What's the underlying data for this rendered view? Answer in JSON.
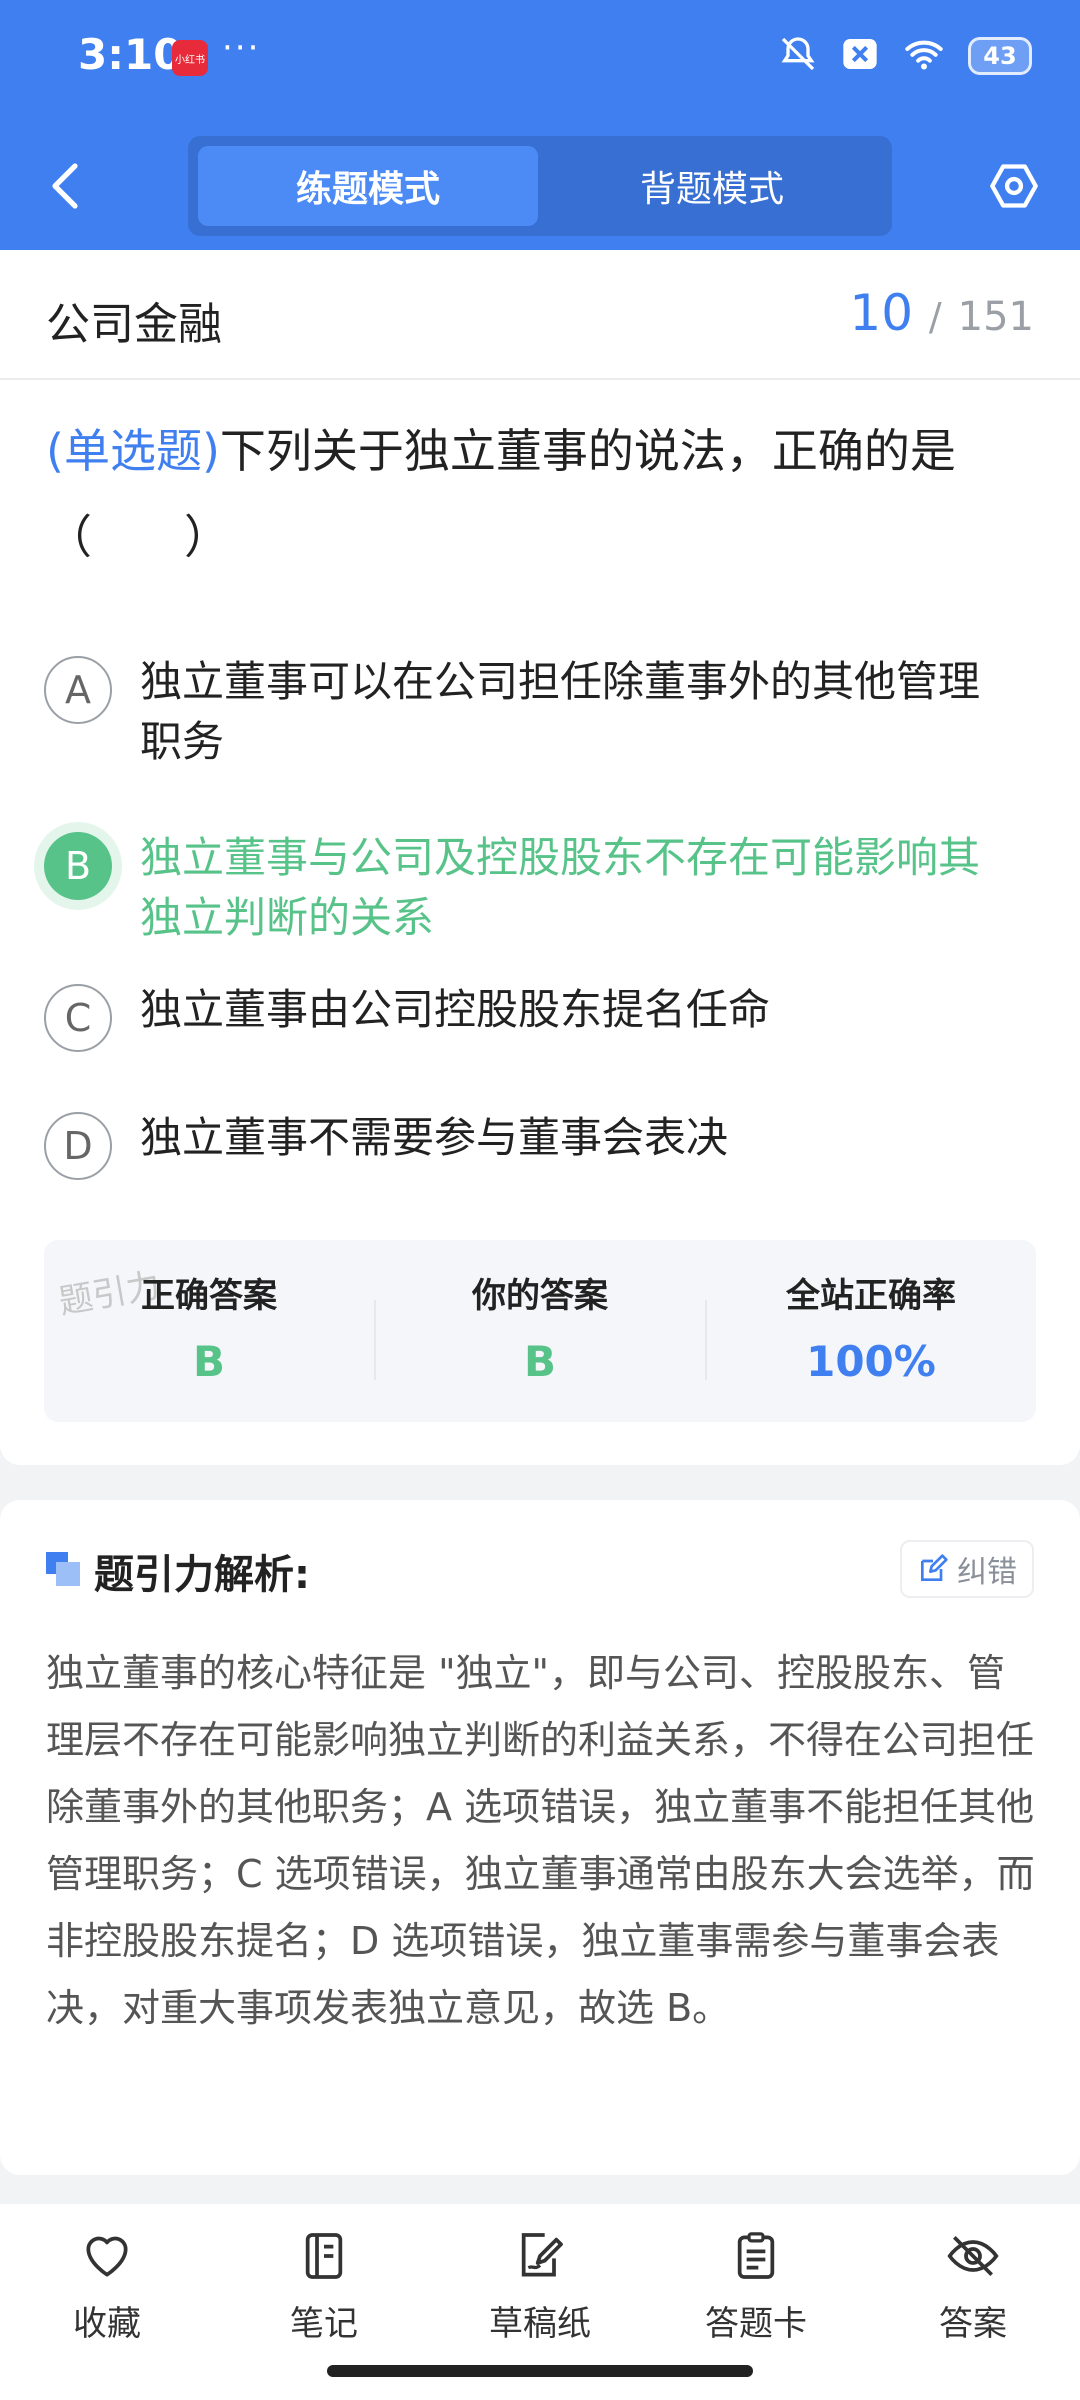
{
  "status_bar": {
    "time": "3:10",
    "app_badge": "小红书",
    "more": "···",
    "battery": "43"
  },
  "header": {
    "modes": [
      {
        "label": "练题模式",
        "active": true
      },
      {
        "label": "背题模式",
        "active": false
      }
    ]
  },
  "question_card": {
    "subject": "公司金融",
    "progress": {
      "current": "10",
      "separator": "/",
      "total": "151"
    },
    "question_type": "(单选题)",
    "question_text": "下列关于独立董事的说法，正确的是（　　）",
    "options": [
      {
        "letter": "A",
        "text": "独立董事可以在公司担任除董事外的其他管理职务",
        "correct": false
      },
      {
        "letter": "B",
        "text": "独立董事与公司及控股股东不存在可能影响其独立判断的关系",
        "correct": true
      },
      {
        "letter": "C",
        "text": "独立董事由公司控股股东提名任命",
        "correct": false
      },
      {
        "letter": "D",
        "text": "独立董事不需要参与董事会表决",
        "correct": false
      }
    ],
    "watermark": "题引力",
    "stats": [
      {
        "label": "正确答案",
        "value": "B",
        "color": "#57c389"
      },
      {
        "label": "你的答案",
        "value": "B",
        "color": "#57c389"
      },
      {
        "label": "全站正确率",
        "value": "100%",
        "color": "#3f7ff0"
      }
    ]
  },
  "analysis": {
    "title": "题引力解析:",
    "correct_button": "纠错",
    "text": "独立董事的核心特征是 \"独立\"，即与公司、控股股东、管理层不存在可能影响独立判断的利益关系，不得在公司担任除董事外的其他职务；A 选项错误，独立董事不能担任其他管理职务；C 选项错误，独立董事通常由股东大会选举，而非控股股东提名；D 选项错误，独立董事需参与董事会表决，对重大事项发表独立意见，故选 B。"
  },
  "bottom_nav": [
    {
      "label": "收藏",
      "icon": "heart-icon"
    },
    {
      "label": "笔记",
      "icon": "notebook-icon"
    },
    {
      "label": "草稿纸",
      "icon": "draft-icon"
    },
    {
      "label": "答题卡",
      "icon": "answer-card-icon"
    },
    {
      "label": "答案",
      "icon": "eye-off-icon"
    }
  ],
  "colors": {
    "primary": "#3f7ff0",
    "correct": "#57c389"
  }
}
